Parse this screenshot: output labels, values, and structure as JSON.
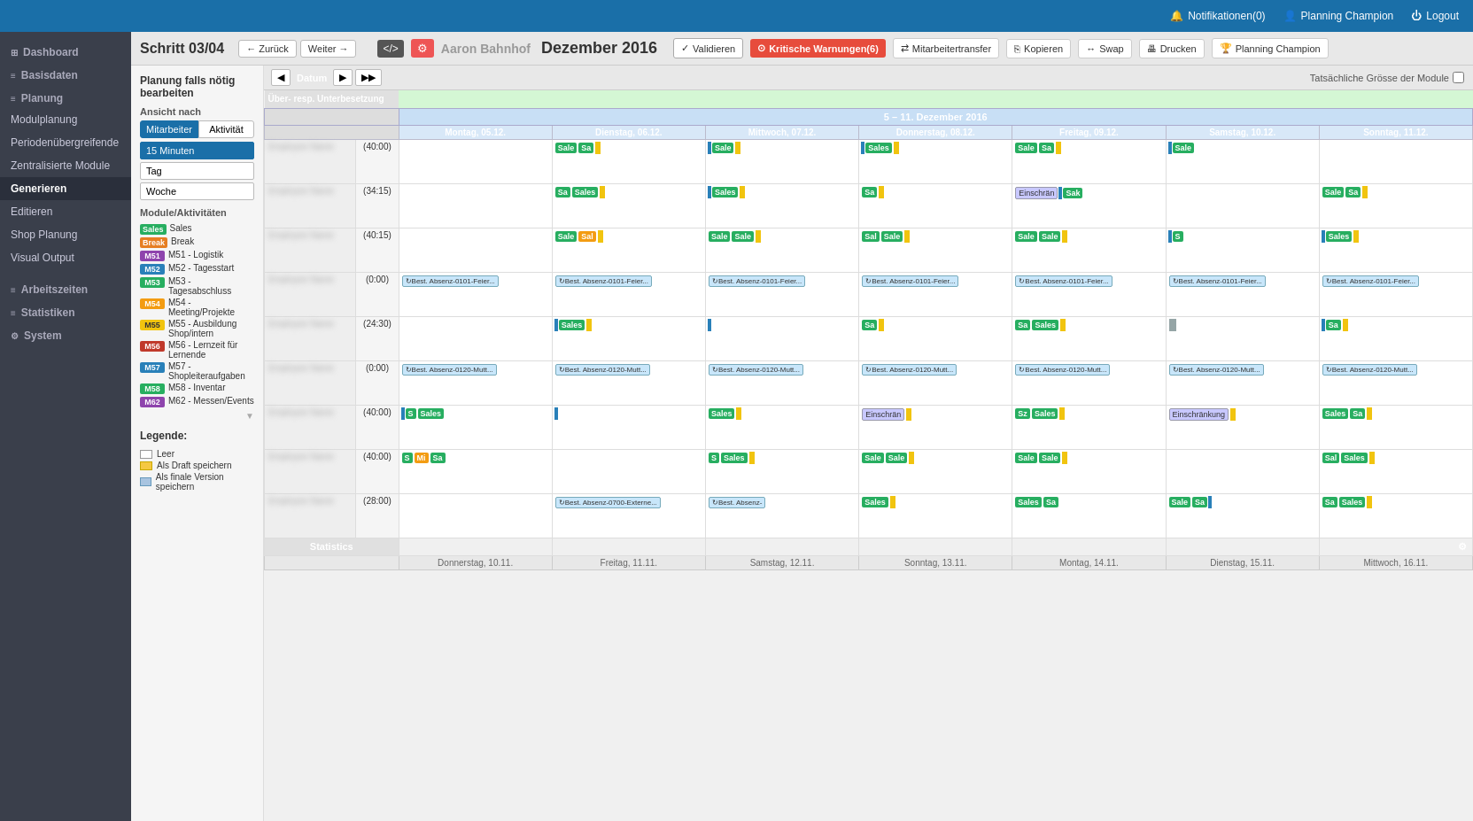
{
  "topbar": {
    "notifications": "Notifikationen(0)",
    "user": "Planning Champion",
    "logout": "Logout"
  },
  "sidebar": {
    "items": [
      {
        "id": "dashboard",
        "label": "Dashboard",
        "icon": "⊞"
      },
      {
        "id": "basisdaten",
        "label": "Basisdaten",
        "icon": "≡"
      },
      {
        "id": "planung",
        "label": "Planung",
        "icon": "≡",
        "section": true
      },
      {
        "id": "modulplanung",
        "label": "Modulplanung"
      },
      {
        "id": "periodenuebergreifende",
        "label": "Periodenübergreifende"
      },
      {
        "id": "zentralisierte",
        "label": "Zentralisierte Module"
      },
      {
        "id": "generieren",
        "label": "Generieren",
        "active": true
      },
      {
        "id": "editieren",
        "label": "Editieren"
      },
      {
        "id": "shop-planung",
        "label": "Shop Planung"
      },
      {
        "id": "visual-output",
        "label": "Visual Output"
      },
      {
        "id": "arbeitszeiten",
        "label": "Arbeitszeiten",
        "icon": "≡",
        "section": true
      },
      {
        "id": "statistiken",
        "label": "Statistiken",
        "icon": "≡",
        "section": true
      },
      {
        "id": "system",
        "label": "System",
        "icon": "⚙",
        "section": true
      }
    ]
  },
  "left_panel": {
    "title": "Planung falls nötig bearbeiten",
    "view_section": "Ansicht nach",
    "view_buttons": [
      "Mitarbeiter",
      "Aktivität"
    ],
    "time_buttons": [
      "15 Minuten",
      "Tag",
      "Woche"
    ],
    "active_time": "15 Minuten",
    "active_view": "Mitarbeiter",
    "modules_title": "Module/Aktivitäten",
    "modules": [
      {
        "id": "sales",
        "label": "Sales",
        "badge": "Sales",
        "color": "#27ae60"
      },
      {
        "id": "break",
        "label": "Break",
        "badge": "Break",
        "color": "#e67e22"
      },
      {
        "id": "m51",
        "label": "M51 - Logistik",
        "badge": "M51",
        "color": "#8e44ad"
      },
      {
        "id": "m52",
        "label": "M52 - Tagesstart",
        "badge": "M52",
        "color": "#2980b9"
      },
      {
        "id": "m53",
        "label": "M53 - Tagesabschluss",
        "badge": "M53",
        "color": "#27ae60"
      },
      {
        "id": "m54",
        "label": "M54 - Meeting/Projekte",
        "badge": "M54",
        "color": "#f39c12"
      },
      {
        "id": "m55",
        "label": "M55 - Ausbildung Shop/intern",
        "badge": "M55",
        "color": "#f1c40f"
      },
      {
        "id": "m56",
        "label": "M56 - Lernzeit für Lernende",
        "badge": "M56",
        "color": "#c0392b"
      },
      {
        "id": "m57",
        "label": "M57 - Shopleiteraufgaben",
        "badge": "M57",
        "color": "#2980b9"
      },
      {
        "id": "m58",
        "label": "M58 - Inventar",
        "badge": "M58",
        "color": "#27ae60"
      },
      {
        "id": "m62",
        "label": "M62 - Messen/Events",
        "badge": "M62",
        "color": "#8e44ad"
      }
    ],
    "legend_title": "Legende:",
    "legend_items": [
      {
        "label": "Leer",
        "color": "#fff"
      },
      {
        "label": "Als Draft speichern",
        "color": "#f5c842"
      },
      {
        "label": "Als finale Version speichern",
        "color": "#a8c4e0"
      }
    ]
  },
  "header": {
    "step": "Schritt  03/04",
    "back_label": "← Zurück",
    "forward_label": "Weiter →",
    "store_name": "Aaron Bahnhof",
    "month": "Dezember 2016",
    "btn_validieren": "Validieren",
    "btn_warnungen": "Kritische Warnungen(6)",
    "btn_transfer": "Mitarbeitertransfer",
    "btn_kopieren": "Kopieren",
    "btn_swap": "Swap",
    "btn_drucken": "Drucken",
    "btn_champion": "Planning Champion"
  },
  "toolbar": {
    "date_label": "Datum",
    "tatsaechlich": "Tatsächliche Grösse der Module"
  },
  "schedule": {
    "week_header": "5 – 11. Dezember 2016",
    "over_under_label": "Über- resp. Unterbesetzung",
    "days": [
      {
        "label": "Montag, 05.12."
      },
      {
        "label": "Dienstag, 06.12."
      },
      {
        "label": "Mittwoch, 07.12."
      },
      {
        "label": "Donnerstag, 08.12."
      },
      {
        "label": "Freitag, 09.12."
      },
      {
        "label": "Samstag, 10.12."
      },
      {
        "label": "Sonntag, 11.12."
      }
    ],
    "employees": [
      {
        "name": "blurred-name-1",
        "hours": "(40:00)",
        "days": [
          {
            "blocks": []
          },
          {
            "blocks": [
              {
                "type": "green",
                "text": "Sale"
              },
              {
                "type": "green",
                "text": "Sa"
              },
              {
                "type": "yellow-bar"
              }
            ]
          },
          {
            "blocks": [
              {
                "type": "blue-bar"
              },
              {
                "type": "green",
                "text": "Sale"
              },
              {
                "type": "yellow-bar"
              }
            ]
          },
          {
            "blocks": [
              {
                "type": "blue-bar"
              },
              {
                "type": "green",
                "text": "Sales"
              },
              {
                "type": "yellow-bar"
              }
            ]
          },
          {
            "blocks": [
              {
                "type": "green",
                "text": "Sale"
              },
              {
                "type": "green",
                "text": "Sa"
              },
              {
                "type": "yellow-bar"
              }
            ]
          },
          {
            "blocks": [
              {
                "type": "blue-bar"
              },
              {
                "type": "green",
                "text": ""
              }
            ]
          },
          {
            "blocks": []
          }
        ]
      },
      {
        "name": "blurred-name-2",
        "hours": "(34:15)",
        "days": [
          {
            "blocks": []
          },
          {
            "blocks": [
              {
                "type": "green",
                "text": "Sa"
              },
              {
                "type": "green",
                "text": "Sales"
              },
              {
                "type": "yellow-bar"
              }
            ]
          },
          {
            "blocks": [
              {
                "type": "blue-bar"
              },
              {
                "type": "green",
                "text": "Sales"
              },
              {
                "type": "yellow-bar"
              }
            ]
          },
          {
            "blocks": [
              {
                "type": "green",
                "text": "Sa"
              },
              {
                "type": "yellow-bar"
              }
            ]
          },
          {
            "blocks": [
              {
                "type": "purple",
                "text": "Einschrän"
              },
              {
                "type": "blue-bar"
              },
              {
                "type": "green",
                "text": "Sak"
              }
            ]
          },
          {
            "blocks": []
          },
          {
            "blocks": [
              {
                "type": "green",
                "text": "Sale"
              },
              {
                "type": "green",
                "text": "Sa"
              },
              {
                "type": "yellow-bar"
              }
            ]
          }
        ]
      },
      {
        "name": "blurred-name-3",
        "hours": "(40:15)",
        "days": [
          {
            "blocks": []
          },
          {
            "blocks": [
              {
                "type": "green",
                "text": "Sale"
              },
              {
                "type": "orange",
                "text": "Sal"
              },
              {
                "type": "yellow-bar"
              }
            ]
          },
          {
            "blocks": [
              {
                "type": "green",
                "text": "Sale"
              },
              {
                "type": "green",
                "text": "Sale"
              },
              {
                "type": "yellow-bar"
              }
            ]
          },
          {
            "blocks": [
              {
                "type": "green",
                "text": "Sal"
              },
              {
                "type": "green",
                "text": "Sale"
              },
              {
                "type": "yellow-bar"
              }
            ]
          },
          {
            "blocks": [
              {
                "type": "green",
                "text": "Sale"
              },
              {
                "type": "green",
                "text": "Sale"
              },
              {
                "type": "yellow-bar"
              }
            ]
          },
          {
            "blocks": [
              {
                "type": "blue-bar"
              },
              {
                "type": "green",
                "text": "S"
              }
            ]
          },
          {
            "blocks": [
              {
                "type": "blue-bar"
              },
              {
                "type": "green",
                "text": "Sales"
              },
              {
                "type": "yellow-bar"
              }
            ]
          }
        ]
      },
      {
        "name": "blurred-name-4",
        "hours": "(0:00)",
        "absence": true,
        "days": [
          {
            "absence_text": "↻Best. Absenz-0101-Feier..."
          },
          {
            "absence_text": "↻Best. Absenz-0101-Feier..."
          },
          {
            "absence_text": "↻Best. Absenz-0101-Feier..."
          },
          {
            "absence_text": "↻Best. Absenz-0101-Feier..."
          },
          {
            "absence_text": "↻Best. Absenz-0101-Feier..."
          },
          {
            "absence_text": "↻Best. Absenz-0101-Feier..."
          },
          {
            "absence_text": "↻Best. Absenz-0101-Feier..."
          }
        ]
      },
      {
        "name": "blurred-name-5",
        "hours": "(24:30)",
        "days": [
          {
            "blocks": []
          },
          {
            "blocks": [
              {
                "type": "blue-bar"
              },
              {
                "type": "green",
                "text": "Sales"
              },
              {
                "type": "yellow-bar"
              }
            ]
          },
          {
            "blocks": [
              {
                "type": "blue-bar"
              }
            ]
          },
          {
            "blocks": [
              {
                "type": "green",
                "text": "Sa"
              },
              {
                "type": "yellow-bar"
              }
            ]
          },
          {
            "blocks": [
              {
                "type": "green",
                "text": "Sa"
              },
              {
                "type": "green",
                "text": "Sales"
              },
              {
                "type": "yellow-bar"
              }
            ]
          },
          {
            "blocks": [
              {
                "type": "gray-bar"
              }
            ]
          },
          {
            "blocks": [
              {
                "type": "blue-bar"
              },
              {
                "type": "green",
                "text": "Sa"
              },
              {
                "type": "yellow-bar"
              }
            ]
          }
        ]
      },
      {
        "name": "blurred-name-6",
        "hours": "(0:00)",
        "absence": true,
        "days": [
          {
            "absence_text": "↻Best. Absenz-0120-Mutt..."
          },
          {
            "absence_text": "↻Best. Absenz-0120-Mutt..."
          },
          {
            "absence_text": "↻Best. Absenz-0120-Mutt..."
          },
          {
            "absence_text": "↻Best. Absenz-0120-Mutt..."
          },
          {
            "absence_text": "↻Best. Absenz-0120-Mutt..."
          },
          {
            "absence_text": "↻Best. Absenz-0120-Mutt..."
          },
          {
            "absence_text": "↻Best. Absenz-0120-Mutt..."
          }
        ]
      },
      {
        "name": "blurred-name-7",
        "hours": "(40:00)",
        "days": [
          {
            "blocks": [
              {
                "type": "blue-bar"
              },
              {
                "type": "green",
                "text": "S"
              },
              {
                "type": "green",
                "text": "Sales"
              }
            ]
          },
          {
            "blocks": [
              {
                "type": "blue-bar"
              }
            ]
          },
          {
            "blocks": [
              {
                "type": "green",
                "text": "Sales"
              },
              {
                "type": "yellow-bar"
              }
            ]
          },
          {
            "blocks": [
              {
                "type": "purple",
                "text": "Einschrän"
              },
              {
                "type": "yellow-bar"
              }
            ]
          },
          {
            "blocks": [
              {
                "type": "green",
                "text": "Sz"
              },
              {
                "type": "green",
                "text": "Sales"
              },
              {
                "type": "yellow-bar"
              }
            ]
          },
          {
            "blocks": [
              {
                "type": "purple",
                "text": "Einschränkung"
              },
              {
                "type": "yellow-bar"
              }
            ]
          },
          {
            "blocks": [
              {
                "type": "green",
                "text": "Sales"
              },
              {
                "type": "green",
                "text": "Sa"
              },
              {
                "type": "yellow-bar"
              }
            ]
          }
        ]
      },
      {
        "name": "blurred-name-8",
        "hours": "(40:00)",
        "days": [
          {
            "blocks": [
              {
                "type": "green",
                "text": "S"
              },
              {
                "type": "orange",
                "text": "Mi"
              },
              {
                "type": "green",
                "text": "Sa"
              }
            ]
          },
          {
            "blocks": []
          },
          {
            "blocks": [
              {
                "type": "green",
                "text": "S"
              },
              {
                "type": "green",
                "text": "Sales"
              },
              {
                "type": "yellow-bar"
              }
            ]
          },
          {
            "blocks": [
              {
                "type": "green",
                "text": "Sale"
              },
              {
                "type": "green",
                "text": "Sale"
              },
              {
                "type": "yellow-bar"
              }
            ]
          },
          {
            "blocks": [
              {
                "type": "green",
                "text": "Sale"
              },
              {
                "type": "green",
                "text": "Sale"
              },
              {
                "type": "yellow-bar"
              }
            ]
          },
          {
            "blocks": []
          },
          {
            "blocks": [
              {
                "type": "green",
                "text": "Sal"
              },
              {
                "type": "green",
                "text": "Sales"
              },
              {
                "type": "yellow-bar"
              }
            ]
          }
        ]
      },
      {
        "name": "blurred-name-9",
        "hours": "(28:00)",
        "days": [
          {
            "blocks": []
          },
          {
            "absence_text": "↻Best. Absenz-0700-Externe..."
          },
          {
            "absence_text": "↻Best. Absenz-"
          },
          {
            "blocks": [
              {
                "type": "green",
                "text": "Sales"
              },
              {
                "type": "yellow-bar"
              }
            ]
          },
          {
            "blocks": [
              {
                "type": "green",
                "text": "Sales"
              },
              {
                "type": "green",
                "text": "Sa"
              }
            ]
          },
          {
            "blocks": [
              {
                "type": "green",
                "text": "Sale"
              },
              {
                "type": "green",
                "text": "Sa"
              },
              {
                "type": "blue-bar"
              }
            ]
          },
          {
            "blocks": [
              {
                "type": "green",
                "text": "Sa"
              },
              {
                "type": "green",
                "text": "Sales"
              },
              {
                "type": "yellow-bar"
              }
            ]
          }
        ]
      }
    ],
    "prev_week_days": [
      "Donnerstag, 10.11.",
      "Freitag, 11.11.",
      "Samstag, 12.11.",
      "Sonntag, 13.11.",
      "Montag, 14.11.",
      "Dienstag, 15.11.",
      "Mittwoch, 16.11."
    ],
    "stats_label": "Statistics"
  }
}
